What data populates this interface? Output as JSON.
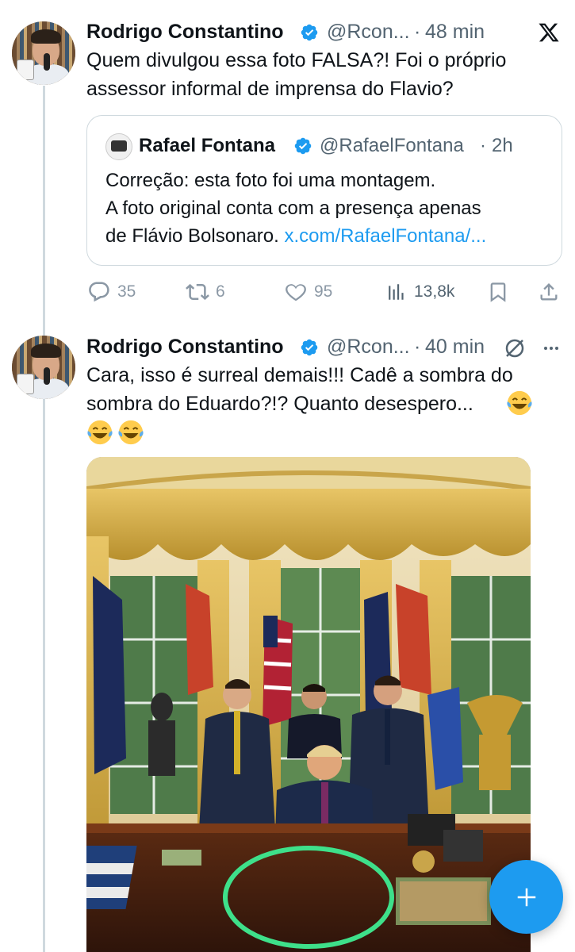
{
  "tweet1": {
    "author_name": "Rodrigo Constantino",
    "handle": "@Rcon...",
    "dot": "·",
    "time": "48 min",
    "text": "Quem divulgou essa foto FALSA?! Foi o próprio assessor informal de imprensa do Flavio?",
    "quote": {
      "author_name": "Rafael Fontana",
      "handle": "@RafaelFontana",
      "dot": "·",
      "time": "2h",
      "text_line1": "Correção: esta foto foi uma montagem.",
      "text_line2": "A foto original conta com a presença apenas",
      "text_line3": "de Flávio Bolsonaro.",
      "link": "x.com/RafaelFontana/..."
    },
    "actions": {
      "replies": "35",
      "reposts": "6",
      "likes": "95",
      "views": "13,8k"
    }
  },
  "tweet2": {
    "author_name": "Rodrigo Constantino",
    "handle": "@Rcon...",
    "dot": "·",
    "time": "40 min",
    "text_line1": "Cara, isso é surreal demais!!! Cadê a sombra do",
    "text_line2": "sombra do Eduardo?!? Quanto desespero...",
    "emoji": "face-with-tears-of-joy"
  },
  "colors": {
    "accent": "#1d9bf0",
    "text": "#0f1419",
    "muted": "#536471",
    "border": "#cfd9de",
    "highlight_circle": "#3ee08a"
  },
  "icons": [
    "x-logo-icon",
    "verified-badge-icon",
    "reply-icon",
    "repost-icon",
    "like-icon",
    "views-icon",
    "bookmark-icon",
    "share-icon",
    "grok-icon",
    "more-icon",
    "compose-plus-icon"
  ]
}
